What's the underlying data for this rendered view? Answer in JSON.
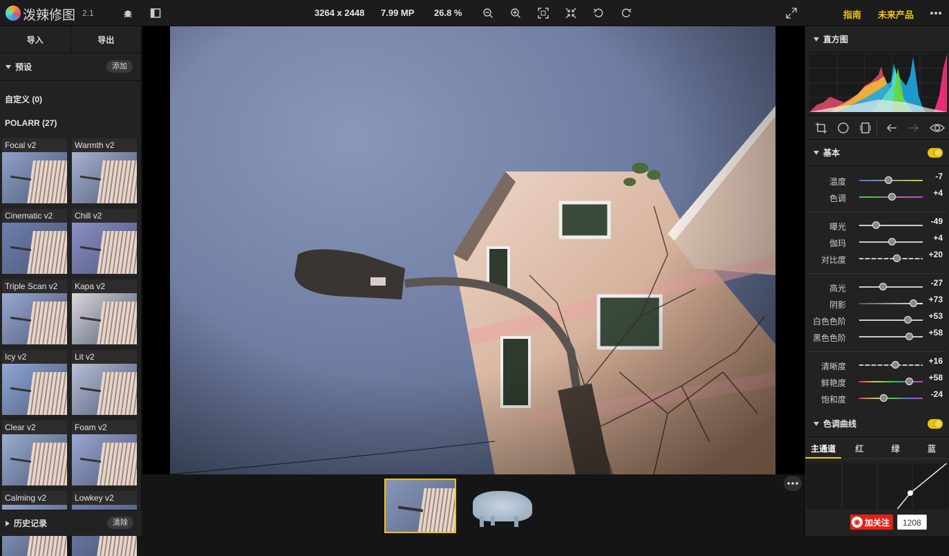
{
  "topbar": {
    "app_name": "泼辣修图",
    "version": "2.1",
    "dimensions": "3264 x 2448",
    "megapixels": "7.99 MP",
    "zoom": "26.8 %",
    "guide": "指南",
    "future": "未来产品",
    "icons": [
      "bug-icon",
      "sidebar-icon",
      "zoom-out-icon",
      "zoom-in-icon",
      "fit-screen-icon",
      "actual-size-icon",
      "rotate-left-icon",
      "rotate-right-icon",
      "fullscreen-icon",
      "more-icon"
    ]
  },
  "left": {
    "import": "导入",
    "export": "导出",
    "presets_title": "预设",
    "add": "添加",
    "custom": "自定义 (0)",
    "polarr": "POLARR (27)",
    "presets": [
      "Focal v2",
      "Warmth v2",
      "Cinematic v2",
      "Chill v2",
      "Triple Scan v2",
      "Kapa v2",
      "Icy v2",
      "Lit v2",
      "Clear v2",
      "Foam v2",
      "Calming v2",
      "Lowkey v2"
    ],
    "history": "历史记录",
    "clear": "清除"
  },
  "right": {
    "histogram": "直方图",
    "basic": "基本",
    "sliders": [
      {
        "label": "温度",
        "value": "-7",
        "pos": 0.46
      },
      {
        "label": "色调",
        "value": "+4",
        "pos": 0.51
      },
      {
        "label": "曝光",
        "value": "-49",
        "pos": 0.26
      },
      {
        "label": "伽玛",
        "value": "+4",
        "pos": 0.51
      },
      {
        "label": "对比度",
        "value": "+20",
        "pos": 0.59
      },
      {
        "label": "高光",
        "value": "-27",
        "pos": 0.37
      },
      {
        "label": "阴影",
        "value": "+73",
        "pos": 0.85
      },
      {
        "label": "白色色阶",
        "value": "+53",
        "pos": 0.76
      },
      {
        "label": "黑色色阶",
        "value": "+58",
        "pos": 0.78
      },
      {
        "label": "清晰度",
        "value": "+16",
        "pos": 0.56
      },
      {
        "label": "鲜艳度",
        "value": "+58",
        "pos": 0.78
      },
      {
        "label": "饱和度",
        "value": "-24",
        "pos": 0.38
      }
    ],
    "curve_title": "色调曲线",
    "channels": [
      "主通道",
      "红",
      "绿",
      "蓝"
    ],
    "tool_icons": [
      "crop-icon",
      "circle-mask-icon",
      "transform-icon",
      "undo-icon",
      "redo-icon",
      "eye-icon"
    ]
  },
  "social": {
    "follow": "加关注",
    "count": "1208"
  },
  "colors": {
    "accent": "#f0c419",
    "toggle": "#e8c30f"
  }
}
